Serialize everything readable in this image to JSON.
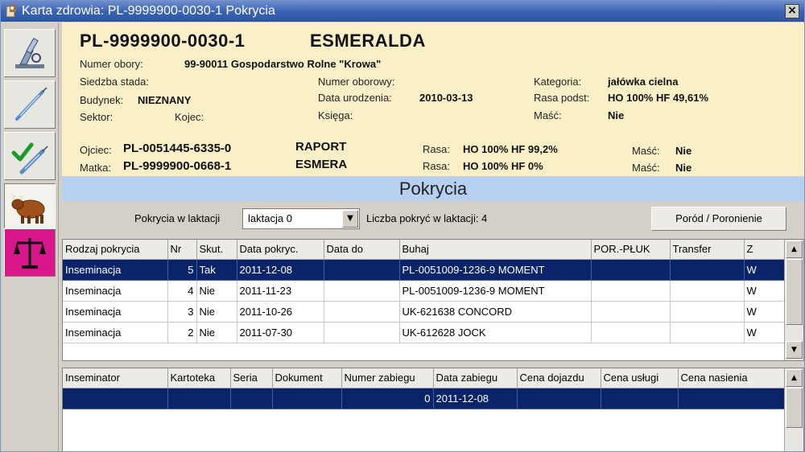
{
  "window": {
    "title": "Karta zdrowia: PL-9999900-0030-1   Pokrycia",
    "close_glyph": "×"
  },
  "sidebar": {
    "items": [
      {
        "name": "microscope-icon"
      },
      {
        "name": "syringe-icon"
      },
      {
        "name": "check-syringe-icon"
      },
      {
        "name": "bull-icon",
        "active": true
      },
      {
        "name": "scales-icon"
      }
    ]
  },
  "animal": {
    "id": "PL-9999900-0030-1",
    "name": "ESMERALDA",
    "numer_obory_label": "Numer obory:",
    "numer_obory_value": "99-90011 Gospodarstwo Rolne \"Krowa\"",
    "siedziba_label": "Siedzba stada:",
    "budynek_label": "Budynek:",
    "budynek_value": "NIEZNANY",
    "sektor_label": "Sektor:",
    "kojec_label": "Kojec:",
    "numer_oborowy_label": "Numer oborowy:",
    "data_urodzenia_label": "Data urodzenia:",
    "data_urodzenia_value": "2010-03-13",
    "ksiega_label": "Księga:",
    "kategoria_label": "Kategoria:",
    "kategoria_value": "jałówka cielna",
    "rasa_podst_label": "Rasa podst:",
    "rasa_podst_value": "HO 100% HF 49,61%",
    "masc_label": "Maść:",
    "masc_value": "Nie"
  },
  "parents": {
    "ojciec_label": "Ojciec:",
    "ojciec_id": "PL-0051445-6335-0",
    "ojciec_name": "RAPORT",
    "ojciec_rasa_label": "Rasa:",
    "ojciec_rasa": "HO 100% HF 99,2%",
    "ojciec_masc_label": "Maść:",
    "ojciec_masc": "Nie",
    "matka_label": "Matka:",
    "matka_id": "PL-9999900-0668-1",
    "matka_name": "ESMERA",
    "matka_rasa_label": "Rasa:",
    "matka_rasa": "HO 100% HF 0%",
    "matka_masc_label": "Maść:",
    "matka_masc": "Nie"
  },
  "section": {
    "title": "Pokrycia"
  },
  "controls": {
    "lactation_label": "Pokrycia w laktacji",
    "lactation_value": "laktacja 0",
    "dropdown_arrow": "▼",
    "count_label": "Liczba pokryć w laktacji: 4",
    "porod_button": "Poród / Poronienie"
  },
  "coverings": {
    "columns": [
      "Rodzaj pokrycia",
      "Nr",
      "Skut.",
      "Data pokryc.",
      "Data do",
      "Buhaj",
      "POR.-PŁUK",
      "Transfer",
      "Z"
    ],
    "rows": [
      {
        "rodzaj": "Inseminacja",
        "nr": "5",
        "skut": "Tak",
        "data": "2011-12-08",
        "data_do": "",
        "buhaj": "PL-0051009-1236-9 MOMENT",
        "por": "",
        "transfer": "",
        "z": "W",
        "selected": true
      },
      {
        "rodzaj": "Inseminacja",
        "nr": "4",
        "skut": "Nie",
        "data": "2011-11-23",
        "data_do": "",
        "buhaj": "PL-0051009-1236-9 MOMENT",
        "por": "",
        "transfer": "",
        "z": "W"
      },
      {
        "rodzaj": "Inseminacja",
        "nr": "3",
        "skut": "Nie",
        "data": "2011-10-26",
        "data_do": "",
        "buhaj": "UK-621638 CONCORD",
        "por": "",
        "transfer": "",
        "z": "W"
      },
      {
        "rodzaj": "Inseminacja",
        "nr": "2",
        "skut": "Nie",
        "data": "2011-07-30",
        "data_do": "",
        "buhaj": "UK-612628 JOCK",
        "por": "",
        "transfer": "",
        "z": "W"
      }
    ]
  },
  "details": {
    "columns": [
      "Inseminator",
      "Kartoteka",
      "Seria",
      "Dokument",
      "Numer zabiegu",
      "Data zabiegu",
      "Cena dojazdu",
      "Cena usługi",
      "Cena nasienia"
    ],
    "rows": [
      {
        "inseminator": "",
        "kartoteka": "",
        "seria": "",
        "dokument": "",
        "numer": "0",
        "data": "2011-12-08",
        "cena_dojazdu": "",
        "cena_uslugi": "",
        "cena_nasienia": "",
        "selected": true
      }
    ]
  },
  "scroll": {
    "up": "▲",
    "down": "▼"
  }
}
